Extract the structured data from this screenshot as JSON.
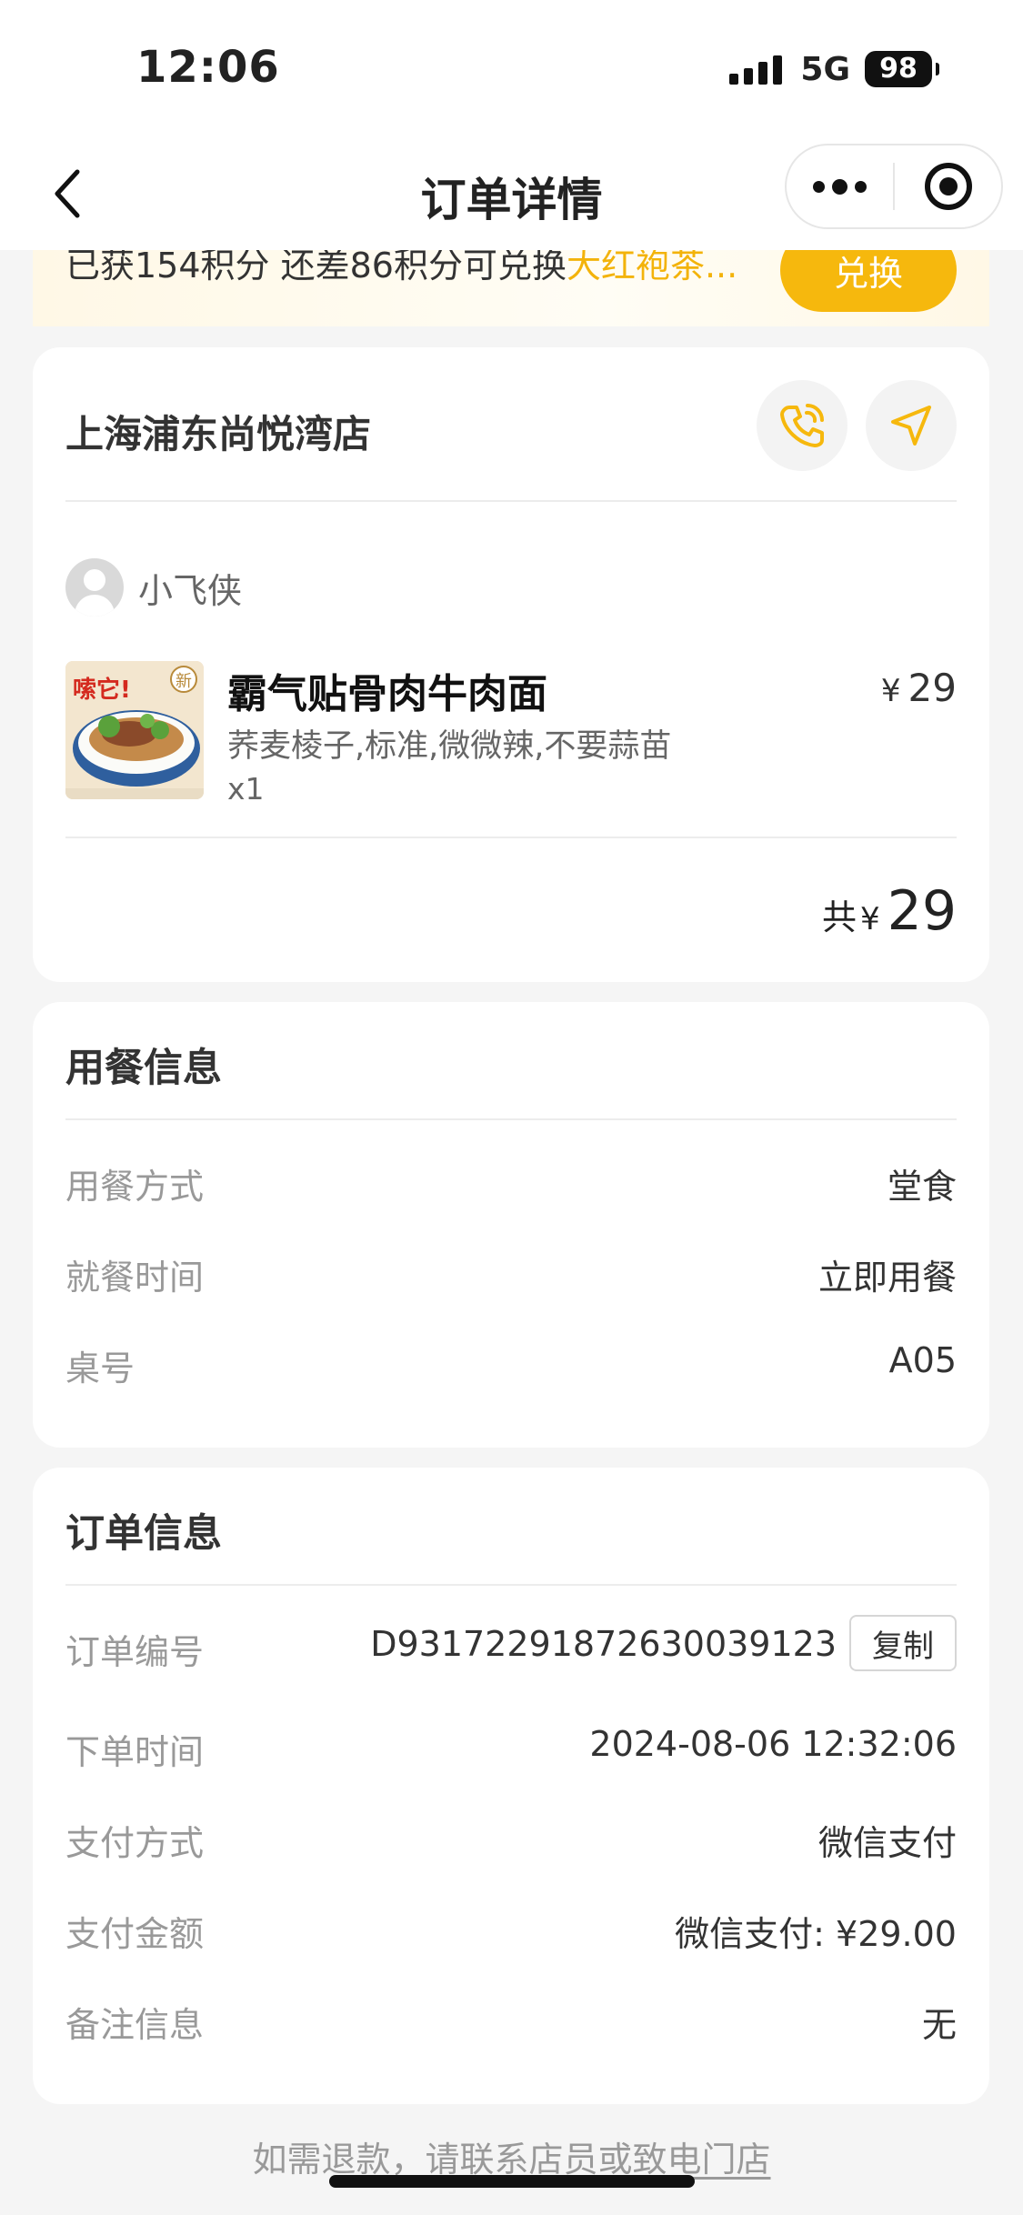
{
  "status_bar": {
    "time": "12:06",
    "network": "5G",
    "battery": "98"
  },
  "nav": {
    "title": "订单详情"
  },
  "points_banner": {
    "text": "已获154积分 还差86积分可兑换",
    "highlight": "大红袍茶...",
    "button": "兑换"
  },
  "store": {
    "name": "上海浦东尚悦湾店",
    "user_name": "小飞侠",
    "item": {
      "name": "霸气贴骨肉牛肉面",
      "spec": "荞麦棱子,标准,微微辣,不要蒜苗",
      "qty": "x1",
      "currency": "¥",
      "price": "29",
      "image_badge_left": "嗦它!",
      "image_badge_right": "新"
    },
    "total_label": "共",
    "total_currency": "¥",
    "total_amount": "29"
  },
  "dining": {
    "title": "用餐信息",
    "rows": [
      {
        "k": "用餐方式",
        "v": "堂食"
      },
      {
        "k": "就餐时间",
        "v": "立即用餐"
      },
      {
        "k": "桌号",
        "v": "A05"
      }
    ]
  },
  "order": {
    "title": "订单信息",
    "order_no_label": "订单编号",
    "order_no": "D93172291872630039123",
    "copy": "复制",
    "rows": [
      {
        "k": "下单时间",
        "v": "2024-08-06 12:32:06"
      },
      {
        "k": "支付方式",
        "v": "微信支付"
      },
      {
        "k": "支付金额",
        "v": "微信支付: ¥29.00"
      },
      {
        "k": "备注信息",
        "v": "无"
      }
    ]
  },
  "footer": {
    "prefix": "如需退款，请",
    "link": "联系店员或致电门店"
  },
  "colors": {
    "accent": "#f6b80d",
    "background": "#f5f5f5"
  }
}
